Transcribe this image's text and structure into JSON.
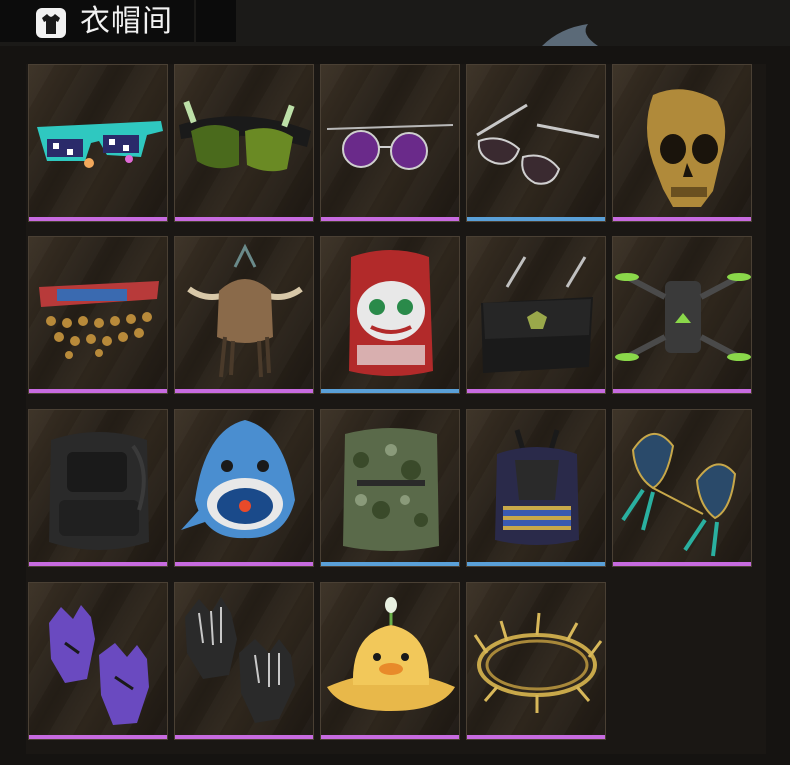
{
  "header": {
    "title": "衣帽间",
    "icon": "hanger-shirt-icon"
  },
  "rarity_colors": {
    "epic": "#c76be0",
    "rare": "#5aa0d8"
  },
  "items": [
    {
      "name": "pixel-sunglasses",
      "rarity": "epic"
    },
    {
      "name": "green-ski-goggles",
      "rarity": "epic"
    },
    {
      "name": "purple-round-sunglasses",
      "rarity": "epic"
    },
    {
      "name": "aviator-sunglasses",
      "rarity": "rare"
    },
    {
      "name": "golden-skull-mask",
      "rarity": "epic"
    },
    {
      "name": "coin-headdress",
      "rarity": "epic"
    },
    {
      "name": "horned-tribal-helmet",
      "rarity": "epic"
    },
    {
      "name": "lion-dance-backpack",
      "rarity": "rare"
    },
    {
      "name": "black-messenger-bag",
      "rarity": "epic"
    },
    {
      "name": "drone-backpack",
      "rarity": "epic"
    },
    {
      "name": "tactical-black-backpack",
      "rarity": "epic"
    },
    {
      "name": "shark-backpack",
      "rarity": "epic"
    },
    {
      "name": "camo-backpack",
      "rarity": "rare"
    },
    {
      "name": "pharaoh-backpack",
      "rarity": "rare"
    },
    {
      "name": "mechanical-butterflies",
      "rarity": "epic"
    },
    {
      "name": "purple-gloves",
      "rarity": "epic"
    },
    {
      "name": "skeleton-gloves",
      "rarity": "epic"
    },
    {
      "name": "duck-bucket-hat",
      "rarity": "epic"
    },
    {
      "name": "golden-thorn-crown",
      "rarity": "epic"
    }
  ]
}
